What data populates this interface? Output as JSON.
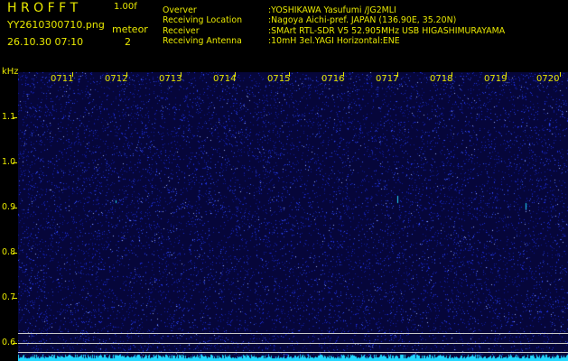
{
  "header": {
    "brand": "H R O F F T",
    "version": "1.00f",
    "filename": "YY2610300710.png",
    "timestamp": "26.10.30 07:10",
    "meteor_label": "meteor",
    "meteor_count": "2"
  },
  "info": [
    {
      "label": "Overver",
      "value": ":YOSHIKAWA Yasufumi /JG2MLI"
    },
    {
      "label": "Receiving Location",
      "value": ":Nagoya Aichi-pref. JAPAN (136.90E, 35.20N)"
    },
    {
      "label": "Receiver",
      "value": ":SMArt RTL-SDR V5 52.905MHz USB HIGASHIMURAYAMA"
    },
    {
      "label": "Receiving Antenna",
      "value": ":10mH 3el.YAGI Horizontal:ENE"
    }
  ],
  "axis": {
    "y_unit": "kHz",
    "y_ticks": [
      "1.1",
      "1.0",
      "0.9",
      "0.8",
      "0.7",
      "0.6"
    ],
    "x_ticks": [
      "0711",
      "0712",
      "0713",
      "0714",
      "0715",
      "0716",
      "0717",
      "0718",
      "0719",
      "0720"
    ]
  },
  "colors": {
    "text": "#e8e800",
    "background": "#06063a",
    "noise": "#1a2aff",
    "trace": "#22d8ff"
  }
}
